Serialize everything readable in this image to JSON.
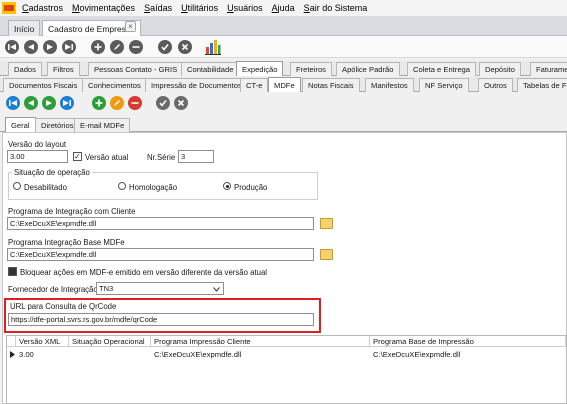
{
  "menubar": {
    "items": [
      {
        "label": "Cadastros",
        "u": "C",
        "rest": "adastros"
      },
      {
        "label": "Movimentações",
        "u": "M",
        "rest": "ovimentações"
      },
      {
        "label": "Saídas",
        "u": "S",
        "rest": "aídas"
      },
      {
        "label": "Utilitários",
        "u": "U",
        "rest": "tilitários"
      },
      {
        "label": "Usuários",
        "u": "U",
        "rest": "suários"
      },
      {
        "label": "Ajuda",
        "u": "A",
        "rest": "juda"
      },
      {
        "label": "Sair do Sistema",
        "u": "S",
        "rest": "air do Sistema"
      }
    ]
  },
  "doc_tabs": [
    "Início",
    "Cadastro de Empresas"
  ],
  "close_glyph": "×",
  "main_tabs": [
    "Dados",
    "Filtros",
    "Pessoas Contato - GRIS",
    "Contabilidade",
    "Expedição",
    "Freteiros",
    "Apólice Padrão",
    "Coleta e Entrega",
    "Depósito",
    "Faturame"
  ],
  "sub_tabs": [
    "Documentos Fiscais",
    "Conhecimentos",
    "Impressão de Documentos",
    "CT-e",
    "MDFe",
    "Notas Fiscais",
    "Manifestos",
    "NF Serviço",
    "Outros",
    "Tabelas de F"
  ],
  "inner_tabs": [
    "Geral",
    "Diretórios",
    "E-mail MDFe"
  ],
  "form": {
    "versao_layout_label": "Versão do layout",
    "versao_layout_value": "3.00",
    "versao_atual_label": "Versão atual",
    "nr_serie_label": "Nr.Série",
    "nr_serie_value": "3",
    "situacao_label": "Situação de operação",
    "radio_desabilitado": "Desabilitado",
    "radio_homologacao": "Homologação",
    "radio_producao": "Produção",
    "selected_situacao": "Produção",
    "prog_cliente_label": "Programa de Integração com Cliente",
    "prog_cliente_value": "C:\\ExeDcuXE\\expmdfe.dll",
    "prog_base_label": "Programa Integração Base MDFe",
    "prog_base_value": "C:\\ExeDcuXE\\expmdfe.dll",
    "bloquear_label": "Bloquear ações em MDF-e emitido em versão diferente da versão atual",
    "fornecedor_label": "Fornecedor de Integração",
    "fornecedor_value": "TN3",
    "url_label": "URL para Consulta de QrCode",
    "url_value": "https://dfe-portal.svrs.rs.gov.br/mdfe/qrCode"
  },
  "grid": {
    "columns": [
      "Versão XML",
      "Situação Operacional",
      "Programa Impressão Cliente",
      "Programa Base de Impressão"
    ],
    "rows": [
      {
        "versao": "3.00",
        "situacao": "",
        "prog_cliente": "C:\\ExeDcuXE\\expmdfe.dll",
        "prog_base": "C:\\ExeDcuXE\\expmdfe.dll"
      }
    ]
  },
  "colors": {
    "highlight_border": "#e02020",
    "accent_blue": "#1c7fd6",
    "ok_green": "#2f9c3a"
  },
  "icons": [
    "first-record-icon",
    "prior-record-icon",
    "next-record-icon",
    "last-record-icon",
    "add-icon",
    "edit-icon",
    "delete-icon",
    "confirm-icon",
    "cancel-icon",
    "report-chart-icon",
    "folder-icon"
  ]
}
